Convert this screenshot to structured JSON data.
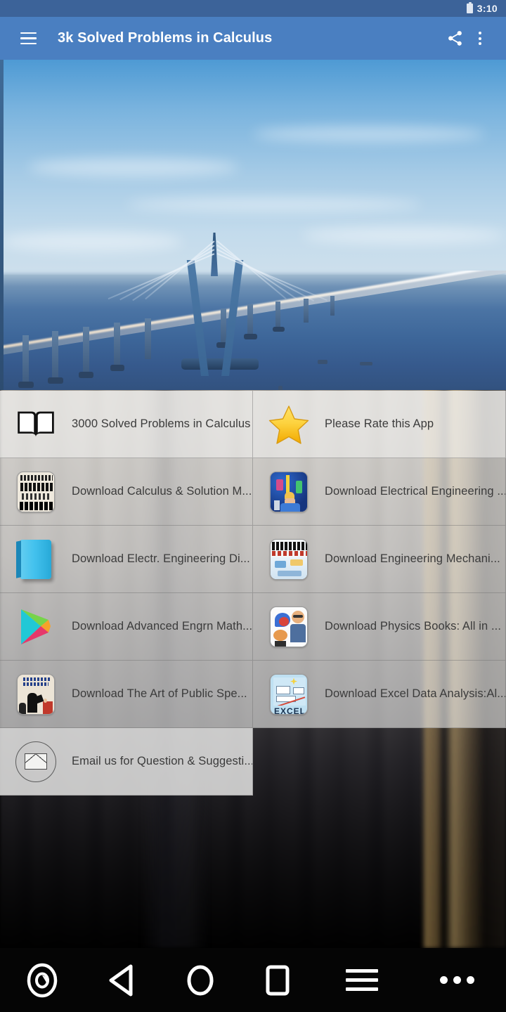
{
  "status_bar": {
    "time": "3:10",
    "battery_icon": "battery-icon"
  },
  "app_bar": {
    "title": "3k Solved Problems in Calculus",
    "menu_icon": "hamburger-menu-icon",
    "share_icon": "share-icon",
    "overflow_icon": "overflow-menu-icon",
    "background_color": "#4a7fc1"
  },
  "hero": {
    "alt": "cable-stayed bridge over sea",
    "sky_color": "#79b3de",
    "water_color": "#3d6699"
  },
  "list": {
    "rows": [
      [
        {
          "label": "3000 Solved Problems in Calculus",
          "icon": "open-book-icon"
        },
        {
          "label": "Please Rate this App",
          "icon": "star-icon"
        }
      ],
      [
        {
          "label": "Download Calculus & Solution M...",
          "icon": "calculus-book-tile-icon"
        },
        {
          "label": "Download Electrical Engineering ...",
          "icon": "electrical-engineering-tile-icon"
        }
      ],
      [
        {
          "label": "Download Electr. Engineering Di...",
          "icon": "blue-book-icon"
        },
        {
          "label": "Download Engineering Mechani...",
          "icon": "engineering-mechanics-tile-icon"
        }
      ],
      [
        {
          "label": "Download Advanced Engrn Math...",
          "icon": "google-play-icon"
        },
        {
          "label": "Download Physics Books: All in ...",
          "icon": "physics-books-tile-icon"
        }
      ],
      [
        {
          "label": "Download The Art of Public Spe...",
          "icon": "public-speaking-tile-icon"
        },
        {
          "label": "Download Excel Data Analysis:Al...",
          "icon": "excel-data-analysis-tile-icon"
        }
      ],
      [
        {
          "label": "Email us for Question & Suggesti...",
          "icon": "email-envelope-icon"
        },
        {
          "label": "",
          "icon": ""
        }
      ]
    ],
    "text_color": "#3b3b3b"
  },
  "nav_bar": {
    "buttons": [
      {
        "name": "screenshot-button",
        "icon": "screenshot-icon"
      },
      {
        "name": "back-button",
        "icon": "back-triangle-icon"
      },
      {
        "name": "home-button",
        "icon": "home-circle-icon"
      },
      {
        "name": "recents-button",
        "icon": "recents-square-icon"
      },
      {
        "name": "menu-button",
        "icon": "hamburger-menu-icon"
      },
      {
        "name": "more-button",
        "icon": "more-dots-icon"
      }
    ]
  }
}
